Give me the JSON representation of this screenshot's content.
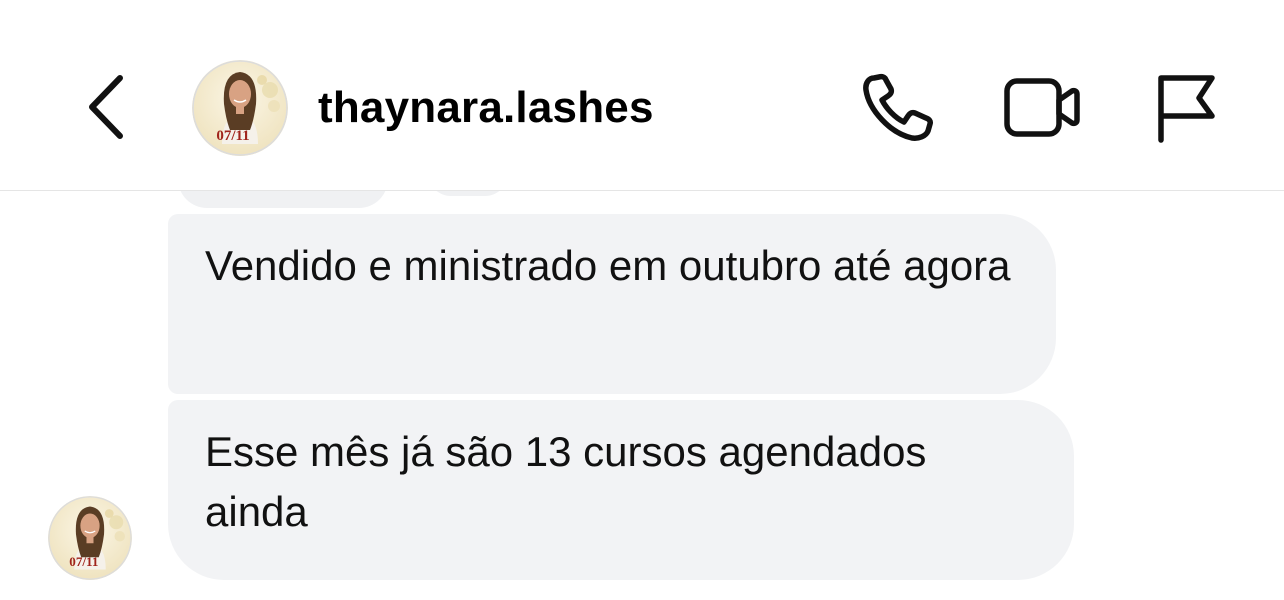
{
  "header": {
    "username": "thaynara.lashes",
    "avatar_text": "07/11",
    "icons": {
      "back": "chevron-left-icon",
      "call": "phone-icon",
      "video": "video-camera-icon",
      "report": "flag-icon"
    }
  },
  "messages": [
    {
      "text": "Vendido e ministrado em outubro até agora"
    },
    {
      "text": "Esse mês já são 13 cursos agendados ainda"
    }
  ],
  "colors": {
    "bubble": "#f2f3f5",
    "divider": "#e5e5e5",
    "icon": "#111111",
    "avatar_text": "#a0241c"
  }
}
